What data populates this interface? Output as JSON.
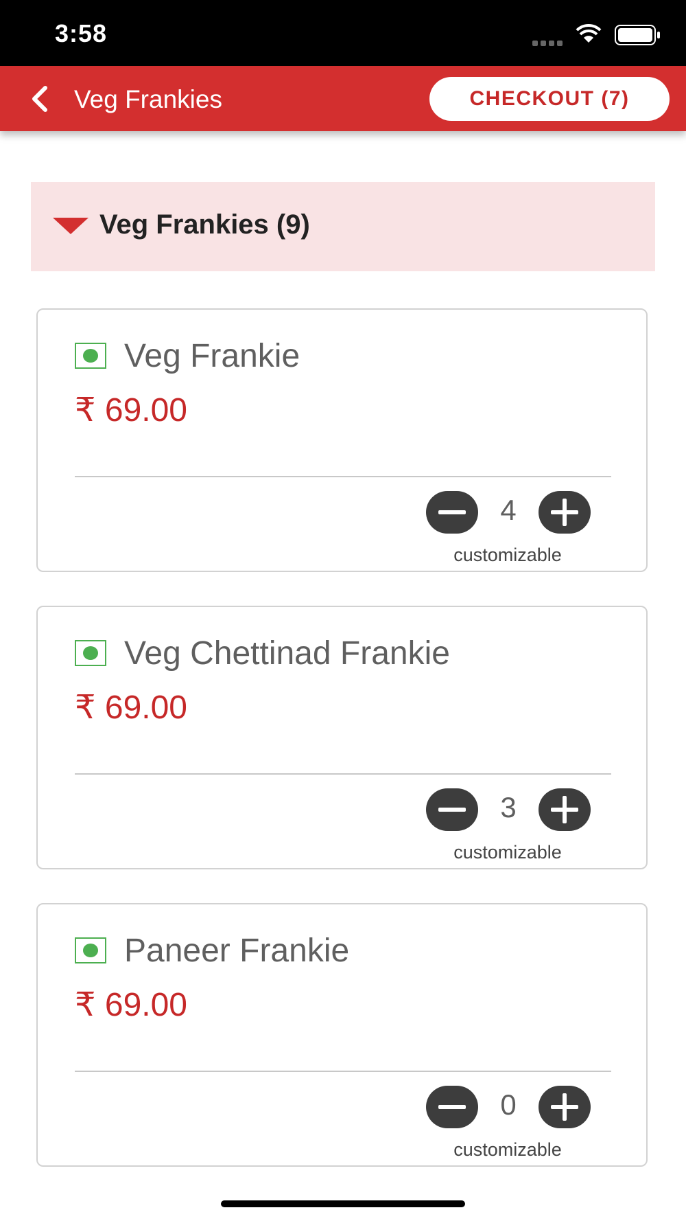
{
  "status_bar": {
    "time": "3:58"
  },
  "nav": {
    "title": "Veg Frankies",
    "checkout_label": "CHECKOUT (7)",
    "accent_color": "#d32f2f"
  },
  "category": {
    "title": "Veg Frankies (9)",
    "expanded": true,
    "background_color": "#f9e3e4"
  },
  "items": [
    {
      "name": "Veg Frankie",
      "price": "₹ 69.00",
      "quantity": "4",
      "note": "customizable"
    },
    {
      "name": "Veg Chettinad Frankie",
      "price": "₹ 69.00",
      "quantity": "3",
      "note": "customizable"
    },
    {
      "name": "Paneer Frankie",
      "price": "₹ 69.00",
      "quantity": "0",
      "note": "customizable"
    }
  ],
  "icons": {
    "back": "chevron-left-icon",
    "collapse": "triangle-down-icon",
    "veg": "veg-indicator-icon",
    "minus": "minus-icon",
    "plus": "plus-icon"
  },
  "colors": {
    "price": "#c62828",
    "veg": "#4caf50",
    "stepper": "#3d3d3d"
  }
}
